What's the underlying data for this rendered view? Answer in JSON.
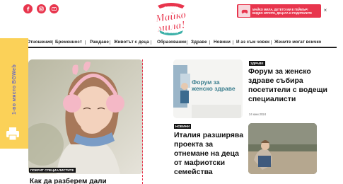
{
  "header": {
    "social": [
      {
        "name": "facebook-icon",
        "color": "#e8354d"
      },
      {
        "name": "instagram-icon",
        "color": "#e8354d"
      },
      {
        "name": "youtube-icon",
        "color": "#e8354d"
      }
    ],
    "logo_text": "Майко мила!",
    "logo_top_text": "МАМО СИ?",
    "logo_bottom_text": "ИЗ ТЪРСИЛКИ",
    "promo_text": "МАЙКО МИЛА, ДЕТЕТО МИ Е ГЕЙМЪР! ВИДЕО ИГРИТЕ, ДЕЦАТА И РОДИТЕЛИТЕ",
    "promo_close": "×",
    "accent_color": "#e8354d"
  },
  "nav": {
    "items": [
      "Отношения",
      "Бременност",
      "Раждане",
      "Животът с деца",
      "Образование",
      "Здраве",
      "Новини",
      "И аз съм човек",
      "Жените могат всичко"
    ]
  },
  "side_tab": {
    "text": "1-во място BGWeb",
    "color": "#fbd158",
    "icon": "printer-icon"
  },
  "feature": {
    "badge": "ПОКРИТ СПЕЦИАЛИСТИТЕ",
    "title": "Как да разберем дали"
  },
  "article_1": {
    "badge": "ЗДРАВЕ",
    "title": "Форум за женско здраве събира посетители с водещи специалисти",
    "date": "24 юни 2024",
    "image_caption": "Форум за женско здраве"
  },
  "article_2": {
    "badge": "НОВИНИ",
    "title": "Италия разширява проекта за отнемане на деца от мафиотски семейства"
  }
}
